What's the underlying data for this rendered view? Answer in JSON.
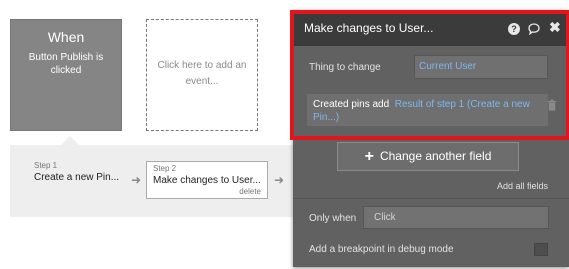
{
  "events": {
    "when_title": "When",
    "when_desc": "Button Publish is clicked",
    "add_event": "Click here to add an event..."
  },
  "steps": [
    {
      "num": "Step 1",
      "name": "Create a new Pin..."
    },
    {
      "num": "Step 2",
      "name": "Make changes to User...",
      "delete": "delete"
    }
  ],
  "panel": {
    "title": "Make changes to User...",
    "thing_label": "Thing to change",
    "thing_value": "Current User",
    "pins_label": "Created pins add",
    "pins_value": "Result of step 1 (Create a new Pin...)",
    "change_button": "Change another field",
    "add_all": "Add all fields",
    "only_when_label": "Only when",
    "only_when_placeholder": "Click",
    "breakpoint_label": "Add a breakpoint in debug mode"
  },
  "icons": {
    "help": "help-icon",
    "chat": "comment-icon",
    "close": "close-icon",
    "trash": "trash-icon",
    "plus": "plus-icon",
    "arrow": "arrow-right-icon"
  },
  "colors": {
    "highlight": "#e3141b",
    "panel_bg": "#616161",
    "header_bg": "#3b3b3b",
    "link": "#7fb7f0",
    "event_card": "#858585"
  }
}
